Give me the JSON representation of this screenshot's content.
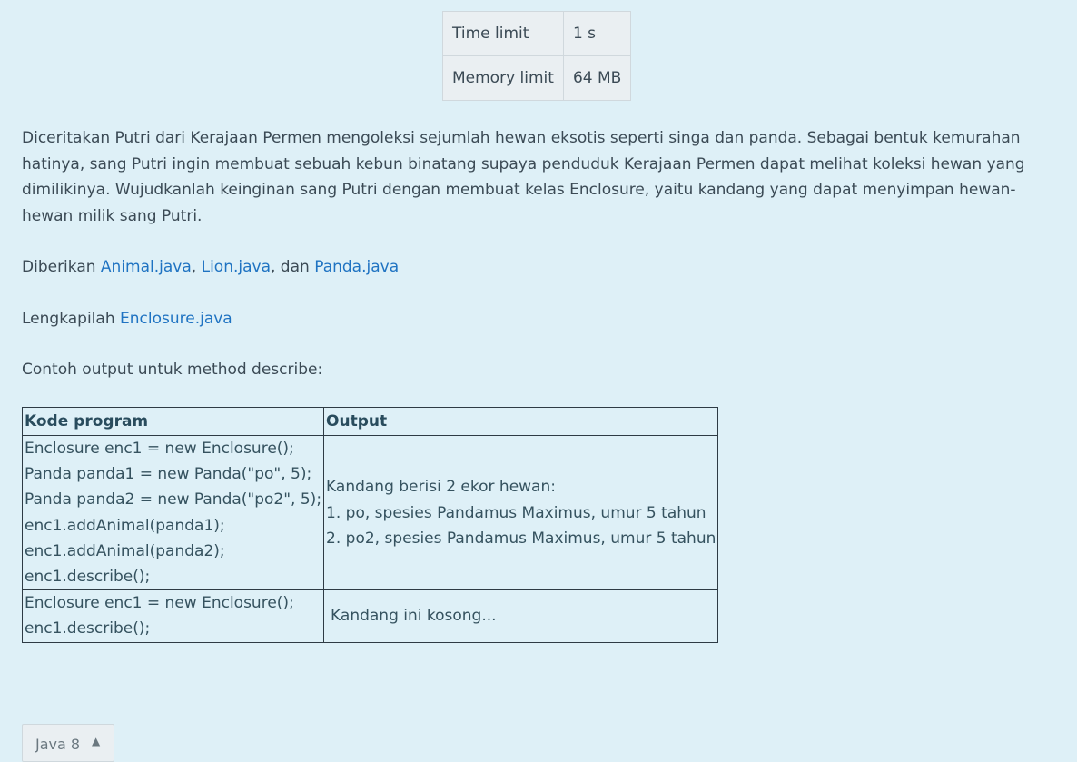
{
  "limits": [
    {
      "label": "Time limit",
      "value": "1 s"
    },
    {
      "label": "Memory limit",
      "value": "64 MB"
    }
  ],
  "description": {
    "paragraph1": "Diceritakan Putri dari Kerajaan Permen mengoleksi sejumlah hewan eksotis seperti singa dan panda. Sebagai bentuk kemurahan hatinya, sang Putri ingin membuat sebuah kebun binatang supaya penduduk Kerajaan Permen dapat melihat koleksi hewan yang dimilikinya. Wujudkanlah keinginan sang Putri dengan membuat kelas Enclosure, yaitu kandang yang dapat menyimpan hewan-hewan milik sang Putri.",
    "given_prefix": "Diberikan ",
    "given_links": [
      "Animal.java",
      "Lion.java",
      "Panda.java"
    ],
    "given_sep1": ", ",
    "given_sep2": ", dan ",
    "complete_prefix": "Lengkapilah ",
    "complete_link": "Enclosure.java",
    "example_intro": "Contoh output untuk method describe:"
  },
  "sample_table": {
    "headers": [
      "Kode program",
      "Output"
    ],
    "rows": [
      {
        "code": [
          "Enclosure enc1 = new Enclosure();",
          "Panda panda1 = new Panda(\"po\", 5);",
          "Panda panda2 = new Panda(\"po2\", 5);",
          "enc1.addAnimal(panda1);",
          "enc1.addAnimal(panda2);",
          "enc1.describe();"
        ],
        "output": [
          "Kandang berisi 2 ekor hewan:",
          "1. po, spesies Pandamus Maximus, umur 5 tahun",
          "2. po2, spesies Pandamus Maximus, umur 5 tahun"
        ]
      },
      {
        "code": [
          "Enclosure enc1 = new Enclosure();",
          "enc1.describe();"
        ],
        "output": [
          "Kandang ini kosong..."
        ]
      }
    ]
  },
  "language_selector": {
    "label": "Java 8",
    "icon": "caret-up-icon"
  }
}
